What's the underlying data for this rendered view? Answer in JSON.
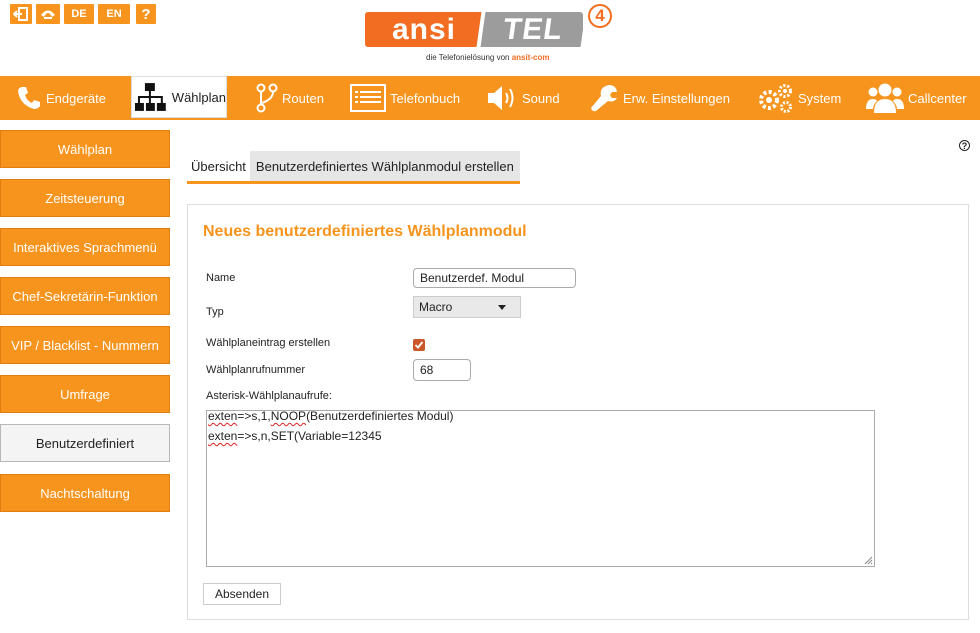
{
  "topbar": {
    "lang_de": "DE",
    "lang_en": "EN",
    "help": "?"
  },
  "logo": {
    "left": "ansi",
    "right": "TEL",
    "badge": "4",
    "tagline": "die Telefonielösung von",
    "brand": "ansit-com"
  },
  "nav": {
    "items": [
      {
        "label": "Endgeräte",
        "icon": "phone-icon"
      },
      {
        "label": "Wählplan",
        "icon": "sitemap-icon"
      },
      {
        "label": "Routen",
        "icon": "route-icon"
      },
      {
        "label": "Telefonbuch",
        "icon": "list-icon"
      },
      {
        "label": "Sound",
        "icon": "speaker-icon"
      },
      {
        "label": "Erw. Einstellungen",
        "icon": "wrench-icon"
      },
      {
        "label": "System",
        "icon": "gears-icon"
      },
      {
        "label": "Callcenter",
        "icon": "users-icon"
      }
    ]
  },
  "sidebar": {
    "items": [
      {
        "label": "Wählplan"
      },
      {
        "label": "Zeitsteuerung"
      },
      {
        "label": "Interaktives Sprachmenü"
      },
      {
        "label": "Chef-Sekretärin-Funktion"
      },
      {
        "label": "VIP / Blacklist - Nummern"
      },
      {
        "label": "Umfrage"
      },
      {
        "label": "Benutzerdefiniert"
      },
      {
        "label": "Nachtschaltung"
      }
    ]
  },
  "tabs": {
    "overview": "Übersicht",
    "create": "Benutzerdefiniertes Wählplanmodul erstellen"
  },
  "help_icon": "?",
  "form": {
    "title": "Neues benutzerdefiniertes Wählplanmodul",
    "name_label": "Name",
    "name_value": "Benutzerdef. Modul",
    "type_label": "Typ",
    "type_value": "Macro",
    "entry_label": "Wählplaneintrag erstellen",
    "entry_checked": true,
    "number_label": "Wählplanrufnummer",
    "number_value": "68",
    "asterisk_label": "Asterisk-Wählplanaufrufe:",
    "line1_a": "exten",
    "line1_b": "=>s,1,",
    "line1_c": "NOOP",
    "line1_d": "(Benutzerdefiniertes Modul)",
    "line2_a": "exten",
    "line2_b": "=>s,n,SET(Variable=12345",
    "submit": "Absenden"
  },
  "colors": {
    "orange": "#f7941d",
    "logo_orange": "#f26d21",
    "logo_grey": "#9c9c9c",
    "checkbox": "#c9572a"
  }
}
